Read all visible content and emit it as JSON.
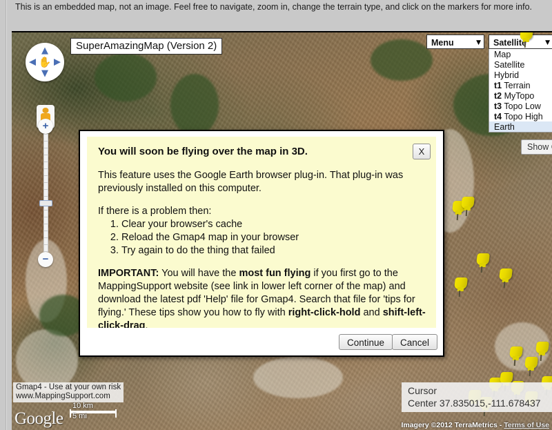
{
  "page": {
    "intro_text": "This is an embedded map, not an image. Feel free to navigate, zoom in, change the terrain type, and click on the markers for more info."
  },
  "map": {
    "title_label": "SuperAmazingMap (Version 2)",
    "menu_button": {
      "label": "Menu",
      "caret": "▼"
    },
    "map_type_button": {
      "label": "Satellite",
      "caret": "▼"
    },
    "map_type_options": [
      {
        "prefix": "",
        "label": "Map",
        "selected": false
      },
      {
        "prefix": "",
        "label": "Satellite",
        "selected": false
      },
      {
        "prefix": "",
        "label": "Hybrid",
        "selected": false
      },
      {
        "prefix": "t1",
        "label": "Terrain",
        "selected": false
      },
      {
        "prefix": "t2",
        "label": "MyTopo",
        "selected": false
      },
      {
        "prefix": "t3",
        "label": "Topo Low",
        "selected": false
      },
      {
        "prefix": "t4",
        "label": "Topo High",
        "selected": false
      },
      {
        "prefix": "",
        "label": "Earth",
        "selected": true
      }
    ],
    "show_grid_button": "Show G",
    "pan_control": {
      "up": "▲",
      "down": "▼",
      "left": "◀",
      "right": "▶",
      "hand": "✋"
    },
    "zoom_control": {
      "zoom_in": "+",
      "zoom_out": "−"
    },
    "attribution": {
      "line1": "Gmap4 - Use at your own risk",
      "line2": "www.MappingSupport.com"
    },
    "google_logo": "Google",
    "scale": {
      "metric": "10 km",
      "imperial": "5 mi"
    },
    "cursor_panel": {
      "line1": "Cursor",
      "line2": "Center 37.835015,-111.678437"
    },
    "imagery_credit": "Imagery ©2012 TerraMetrics",
    "terms_link": "Terms of Use"
  },
  "dialog": {
    "title": "You will soon be flying over the map in 3D.",
    "close_label": "X",
    "paragraph1": "This feature uses the Google Earth browser plug-in. That plug-in was previously installed on this computer.",
    "problem_intro": "If there is a problem then:",
    "steps": [
      "Clear your browser's cache",
      "Reload the Gmap4 map in your browser",
      "Try again to do the thing that failed"
    ],
    "important_label": "IMPORTANT:",
    "important_t1": " You will have the ",
    "important_b1": "most fun flying",
    "important_t2": " if you first go to the MappingSupport website (see link in lower left corner of the map) and download the latest pdf 'Help' file for Gmap4. Search that file for 'tips for flying.' These tips show you how to fly with ",
    "important_b2": "right-click-hold",
    "important_t3": " and ",
    "important_b3": "shift-left-click-drag",
    "important_t4": ".",
    "continue_label": "Continue",
    "cancel_label": "Cancel"
  },
  "colors": {
    "dialog_bg": "#fbfbcf",
    "arrow": "#e50000",
    "marker": "#ece000",
    "selected_option": "#dbe7f5"
  }
}
